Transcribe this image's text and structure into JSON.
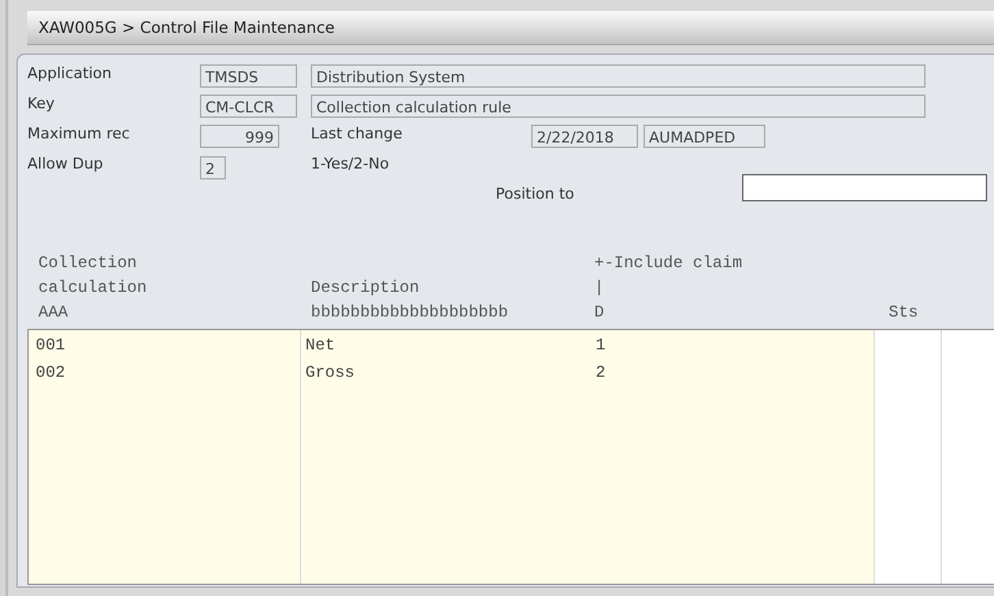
{
  "window": {
    "title": "XAW005G > Control File Maintenance"
  },
  "form": {
    "application": {
      "label": "Application",
      "code": "TMSDS",
      "description": "Distribution System"
    },
    "key": {
      "label": "Key",
      "code": "CM-CLCR",
      "description": "Collection calculation rule"
    },
    "maximum_rec": {
      "label": "Maximum rec",
      "value": "999",
      "last_change_label": "Last change",
      "date": "2/22/2018",
      "user": "AUMADPED"
    },
    "allow_dup": {
      "label": "Allow Dup",
      "value": "2",
      "hint": "1-Yes/2-No"
    },
    "position_to": {
      "label": "Position to"
    }
  },
  "table": {
    "columns": [
      {
        "header_lines": [
          "Collection",
          "calculation",
          "AAA"
        ]
      },
      {
        "header_lines": [
          "Description",
          "bbbbbbbbbbbbbbbbbbbb"
        ]
      },
      {
        "header_lines": [
          "+-Include claim",
          "|",
          "D"
        ]
      },
      {
        "header_lines": [
          "Sts"
        ]
      }
    ],
    "rows": [
      {
        "cells": [
          "001",
          "Net",
          "1"
        ]
      },
      {
        "cells": [
          "002",
          "Gross",
          "2"
        ]
      }
    ]
  }
}
